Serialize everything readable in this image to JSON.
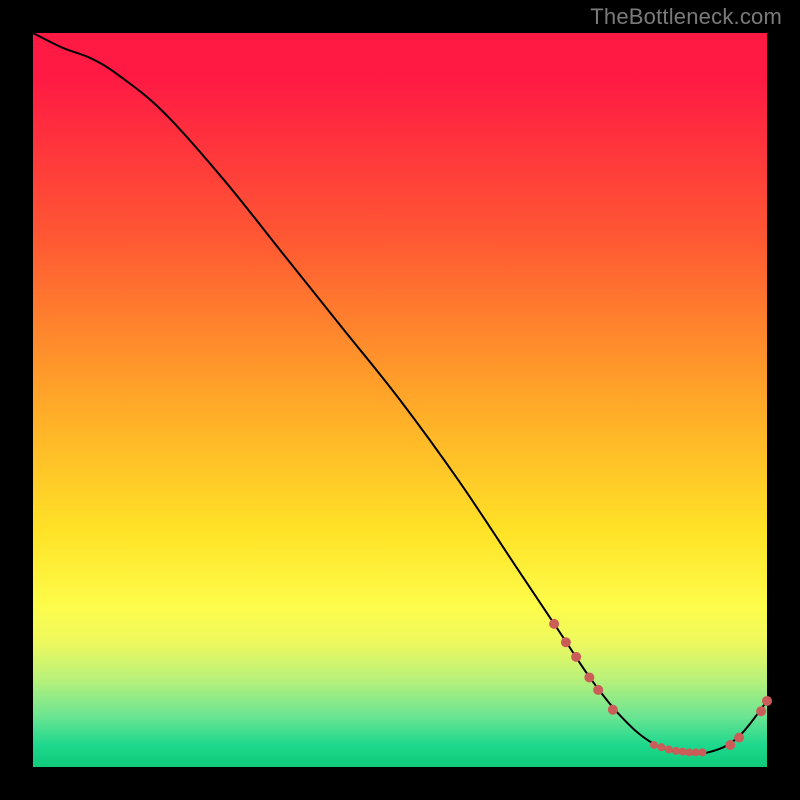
{
  "watermark": "TheBottleneck.com",
  "chart_data": {
    "type": "line",
    "title": "",
    "xlabel": "",
    "ylabel": "",
    "xlim": [
      0,
      100
    ],
    "ylim": [
      0,
      100
    ],
    "grid": false,
    "series": [
      {
        "name": "curve",
        "x": [
          0,
          4,
          8,
          12,
          18,
          26,
          34,
          42,
          50,
          58,
          66,
          72,
          76,
          80,
          84,
          88,
          92,
          96,
          100
        ],
        "y": [
          100,
          98,
          96.5,
          94,
          89,
          80,
          70,
          60,
          50,
          39,
          27,
          18,
          12,
          7,
          3.5,
          2,
          2,
          4,
          9
        ]
      }
    ],
    "markers": {
      "name": "highlighted-points",
      "color": "#cb5d59",
      "points": [
        {
          "x": 71.0,
          "y": 19.5,
          "r": 5
        },
        {
          "x": 72.6,
          "y": 17.0,
          "r": 5
        },
        {
          "x": 74.0,
          "y": 15.0,
          "r": 5
        },
        {
          "x": 75.8,
          "y": 12.2,
          "r": 5
        },
        {
          "x": 77.0,
          "y": 10.5,
          "r": 5
        },
        {
          "x": 79.0,
          "y": 7.8,
          "r": 5
        },
        {
          "x": 84.6,
          "y": 3.0,
          "r": 4
        },
        {
          "x": 85.6,
          "y": 2.7,
          "r": 4
        },
        {
          "x": 86.6,
          "y": 2.4,
          "r": 4
        },
        {
          "x": 87.6,
          "y": 2.2,
          "r": 4
        },
        {
          "x": 88.5,
          "y": 2.1,
          "r": 4
        },
        {
          "x": 89.4,
          "y": 2.0,
          "r": 4
        },
        {
          "x": 90.3,
          "y": 2.0,
          "r": 4
        },
        {
          "x": 91.2,
          "y": 2.0,
          "r": 4
        },
        {
          "x": 95.0,
          "y": 3.0,
          "r": 5
        },
        {
          "x": 96.2,
          "y": 4.0,
          "r": 5
        },
        {
          "x": 99.2,
          "y": 7.6,
          "r": 5
        },
        {
          "x": 100.0,
          "y": 9.0,
          "r": 5
        }
      ]
    }
  }
}
